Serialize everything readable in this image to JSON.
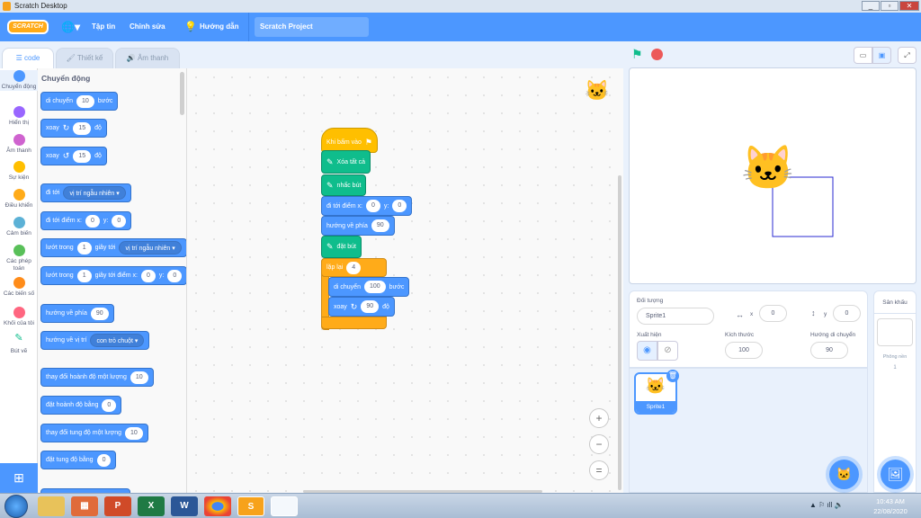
{
  "window": {
    "title": "Scratch Desktop",
    "controls": [
      "_",
      "▫",
      "✕"
    ]
  },
  "menubar": {
    "logo": "SCRATCH",
    "language_icon": "globe-icon",
    "items": [
      "Tập tin",
      "Chỉnh sửa"
    ],
    "tutorials": "Hướng dẫn",
    "project_title": "Scratch Project"
  },
  "tabs": [
    {
      "label": "code",
      "icon": "code-icon",
      "active": true
    },
    {
      "label": "Thiết kế",
      "icon": "brush-icon"
    },
    {
      "label": "Âm thanh",
      "icon": "speaker-icon"
    }
  ],
  "categories": [
    {
      "label": "Chuyển động",
      "color": "#4c97ff",
      "selected": true
    },
    {
      "label": "Hiển thị",
      "color": "#9966ff"
    },
    {
      "label": "Âm thanh",
      "color": "#cf63cf"
    },
    {
      "label": "Sự kiện",
      "color": "#ffbf00"
    },
    {
      "label": "Điều khiển",
      "color": "#ffab19"
    },
    {
      "label": "Cảm biến",
      "color": "#5cb1d6"
    },
    {
      "label": "Các phép toán",
      "color": "#59c059"
    },
    {
      "label": "Các biến số",
      "color": "#ff8c1a"
    },
    {
      "label": "Khối của tôi",
      "color": "#ff6680"
    },
    {
      "label": "Bút vẽ",
      "icon": "pen-icon"
    }
  ],
  "palette": {
    "heading": "Chuyển động",
    "blocks": [
      {
        "parts": [
          {
            "t": "text",
            "v": "di chuyển"
          },
          {
            "t": "num",
            "v": "10"
          },
          {
            "t": "text",
            "v": "bước"
          }
        ]
      },
      {
        "parts": [
          {
            "t": "text",
            "v": "xoay"
          },
          {
            "t": "icon",
            "v": "↻"
          },
          {
            "t": "num",
            "v": "15"
          },
          {
            "t": "text",
            "v": "độ"
          }
        ]
      },
      {
        "parts": [
          {
            "t": "text",
            "v": "xoay"
          },
          {
            "t": "icon",
            "v": "↺"
          },
          {
            "t": "num",
            "v": "15"
          },
          {
            "t": "text",
            "v": "độ"
          }
        ]
      },
      {
        "parts": [
          {
            "t": "text",
            "v": "đi tới"
          },
          {
            "t": "dd",
            "v": "vị trí ngẫu nhiên ▾"
          }
        ]
      },
      {
        "parts": [
          {
            "t": "text",
            "v": "đi tới điểm x:"
          },
          {
            "t": "num",
            "v": "0"
          },
          {
            "t": "text",
            "v": "y:"
          },
          {
            "t": "num",
            "v": "0"
          }
        ]
      },
      {
        "parts": [
          {
            "t": "text",
            "v": "lướt trong"
          },
          {
            "t": "num",
            "v": "1"
          },
          {
            "t": "text",
            "v": "giây tới"
          },
          {
            "t": "dd",
            "v": "vị trí ngẫu nhiên ▾"
          }
        ]
      },
      {
        "parts": [
          {
            "t": "text",
            "v": "lướt trong"
          },
          {
            "t": "num",
            "v": "1"
          },
          {
            "t": "text",
            "v": "giây tới điểm x:"
          },
          {
            "t": "num",
            "v": "0"
          },
          {
            "t": "text",
            "v": "y:"
          },
          {
            "t": "num",
            "v": "0"
          }
        ]
      },
      {
        "parts": [
          {
            "t": "text",
            "v": "hướng về phía"
          },
          {
            "t": "num",
            "v": "90"
          }
        ]
      },
      {
        "parts": [
          {
            "t": "text",
            "v": "hướng về vị trí"
          },
          {
            "t": "dd",
            "v": "con trỏ chuột ▾"
          }
        ]
      },
      {
        "parts": [
          {
            "t": "text",
            "v": "thay đổi hoành độ một lượng"
          },
          {
            "t": "num",
            "v": "10"
          }
        ]
      },
      {
        "parts": [
          {
            "t": "text",
            "v": "đặt hoành độ bằng"
          },
          {
            "t": "num",
            "v": "0"
          }
        ]
      },
      {
        "parts": [
          {
            "t": "text",
            "v": "thay đổi tung độ một lượng"
          },
          {
            "t": "num",
            "v": "10"
          }
        ]
      },
      {
        "parts": [
          {
            "t": "text",
            "v": "đặt tung độ bằng"
          },
          {
            "t": "num",
            "v": "0"
          }
        ]
      }
    ]
  },
  "script": [
    {
      "cat": "event",
      "parts": [
        {
          "t": "text",
          "v": "Khi bấm vào"
        },
        {
          "t": "icon",
          "v": "⚑"
        }
      ]
    },
    {
      "cat": "pen",
      "parts": [
        {
          "t": "icon",
          "v": "✎"
        },
        {
          "t": "text",
          "v": "Xóa tất cả"
        }
      ]
    },
    {
      "cat": "pen",
      "parts": [
        {
          "t": "icon",
          "v": "✎"
        },
        {
          "t": "text",
          "v": "nhấc bút"
        }
      ]
    },
    {
      "cat": "motion",
      "parts": [
        {
          "t": "text",
          "v": "đi tới điểm x:"
        },
        {
          "t": "num",
          "v": "0"
        },
        {
          "t": "text",
          "v": "y:"
        },
        {
          "t": "num",
          "v": "0"
        }
      ]
    },
    {
      "cat": "motion",
      "parts": [
        {
          "t": "text",
          "v": "hướng về phía"
        },
        {
          "t": "num",
          "v": "90"
        }
      ]
    },
    {
      "cat": "pen",
      "parts": [
        {
          "t": "icon",
          "v": "✎"
        },
        {
          "t": "text",
          "v": "đặt bút"
        }
      ]
    },
    {
      "cat": "control",
      "parts": [
        {
          "t": "text",
          "v": "lặp lại"
        },
        {
          "t": "num",
          "v": "4"
        }
      ]
    },
    {
      "cat": "motion",
      "parts": [
        {
          "t": "text",
          "v": "di chuyển"
        },
        {
          "t": "num",
          "v": "100"
        },
        {
          "t": "text",
          "v": "bước"
        }
      ]
    },
    {
      "cat": "motion",
      "parts": [
        {
          "t": "text",
          "v": "xoay"
        },
        {
          "t": "icon",
          "v": "↻"
        },
        {
          "t": "num",
          "v": "90"
        },
        {
          "t": "text",
          "v": "độ"
        }
      ]
    }
  ],
  "zoom_controls": [
    "+",
    "−",
    "="
  ],
  "sprite_info": {
    "label_sprite": "Đối tượng",
    "sprite_name": "Sprite1",
    "x_label": "x",
    "x": "0",
    "y_label": "y",
    "y": "0",
    "show_label": "Xuất hiện",
    "size_label": "Kích thước",
    "size": "100",
    "direction_label": "Hướng di chuyển",
    "direction": "90"
  },
  "sprites": [
    {
      "name": "Sprite1",
      "selected": true
    }
  ],
  "stage_panel": {
    "title": "Sân khấu",
    "backdrops_label": "Phông nền",
    "backdrops_count": "1"
  },
  "taskbar": {
    "time": "10:43 AM",
    "date": "22/08/2020",
    "apps": [
      "explorer",
      "media",
      "powerpoint",
      "excel",
      "word",
      "chrome",
      "scratch",
      "notepad"
    ]
  },
  "colors": {
    "motion": "#4c97ff",
    "pen": "#0fbd8c",
    "control": "#ffab19",
    "event": "#ffbf00",
    "accent": "#4c97ff"
  }
}
